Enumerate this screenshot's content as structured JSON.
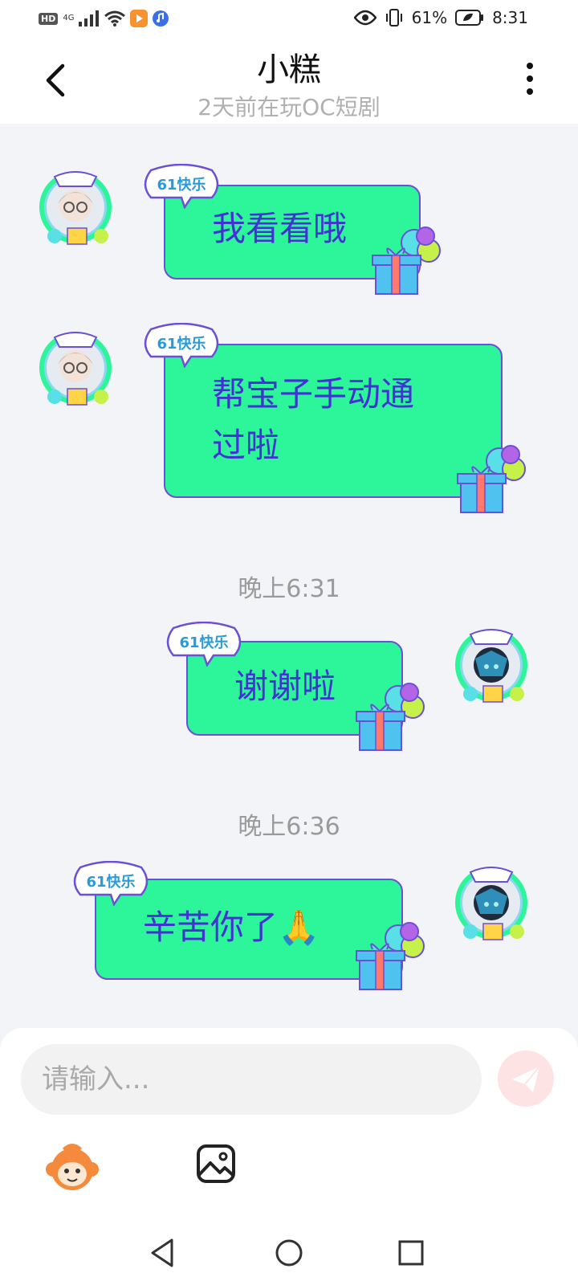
{
  "status_bar": {
    "hd": "HD",
    "network": "4G",
    "battery": "61%",
    "time": "8:31"
  },
  "header": {
    "title": "小糕",
    "subtitle": "2天前在玩OC短剧"
  },
  "messages": [
    {
      "side": "left",
      "text": "我看看哦"
    },
    {
      "side": "left",
      "text_line1": "帮宝子手动通",
      "text_line2": "过啦"
    },
    {
      "timestamp": "晚上6:31"
    },
    {
      "side": "right",
      "text": "谢谢啦"
    },
    {
      "timestamp": "晚上6:36"
    },
    {
      "side": "right",
      "text": "辛苦你了🙏"
    }
  ],
  "badge_text": "61快乐",
  "input": {
    "placeholder": "请输入..."
  },
  "colors": {
    "bubble_fill": "#2df59a",
    "bubble_border": "#6b4fd8",
    "bubble_text": "#4331d6",
    "send_button": "#fde3e3"
  }
}
